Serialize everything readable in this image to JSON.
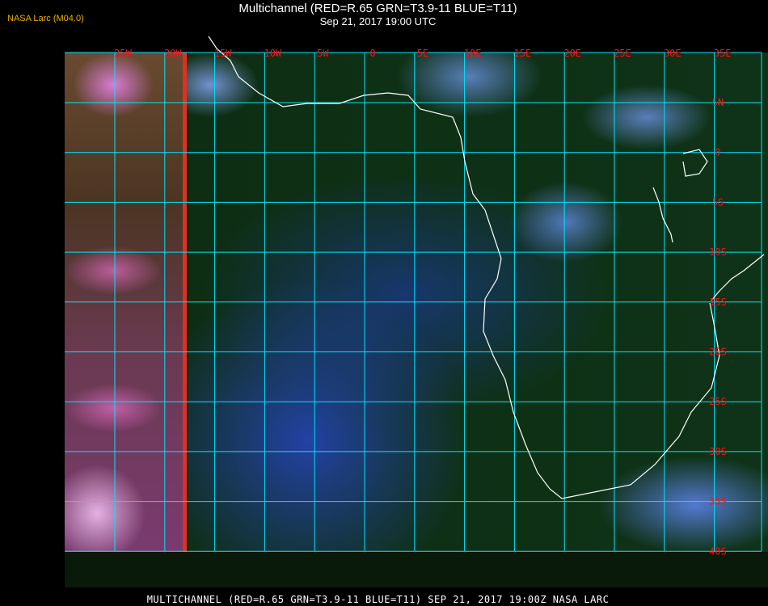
{
  "header": {
    "title": "Multichannel (RED=R.65 GRN=T3.9-11 BLUE=T11)",
    "datetime": "Sep 21, 2017 19:00 UTC",
    "credit": "NASA Larc (M04.0)"
  },
  "grid": {
    "lon_labels": [
      "25W",
      "20W",
      "15W",
      "10W",
      "5W",
      "0",
      "5E",
      "10E",
      "15E",
      "20E",
      "25E",
      "30E",
      "35E"
    ],
    "lat_labels": [
      "5N",
      "0",
      "5S",
      "10S",
      "15S",
      "20S",
      "25S",
      "30S",
      "35S",
      "40S"
    ],
    "grid_color": "#00e5ff",
    "label_color": "#ff1010",
    "coast_color": "#ffffff"
  },
  "footer": {
    "caption": "MULTICHANNEL (RED=R.65 GRN=T3.9-11 BLUE=T11) SEP 21, 2017 19:00Z   NASA LARC"
  }
}
